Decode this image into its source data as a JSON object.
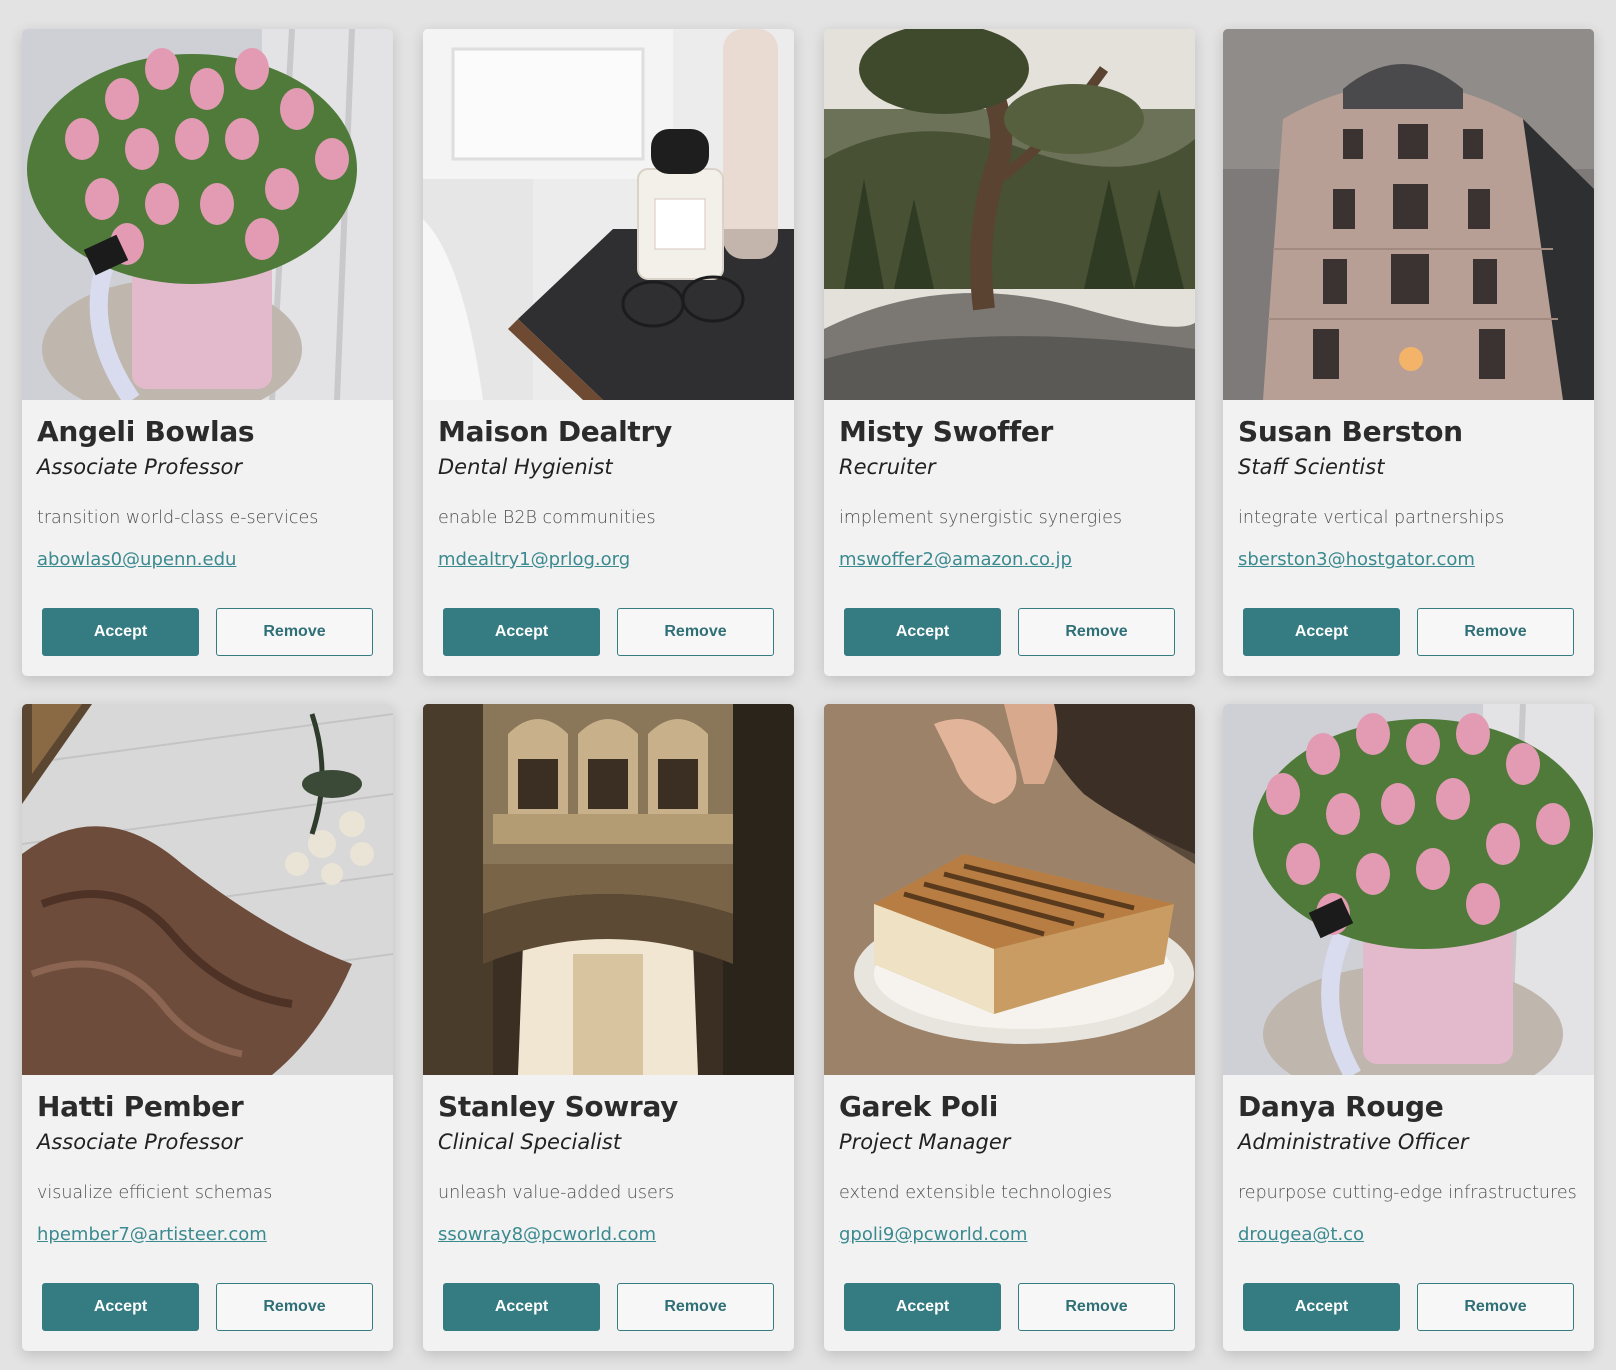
{
  "cards": [
    {
      "name": "Angeli Bowlas",
      "title": "Associate Professor",
      "tagline": "transition world-class e-services",
      "email": "abowlas0@upenn.edu",
      "image": "pink-tulips-photo",
      "accept_label": "Accept",
      "remove_label": "Remove"
    },
    {
      "name": "Maison Dealtry",
      "title": "Dental Hygienist",
      "tagline": "enable B2B communities",
      "email": "mdealtry1@prlog.org",
      "image": "perfume-glasses-photo",
      "accept_label": "Accept",
      "remove_label": "Remove"
    },
    {
      "name": "Misty Swoffer",
      "title": "Recruiter",
      "tagline": "implement synergistic synergies",
      "email": "mswoffer2@amazon.co.jp",
      "image": "pine-tree-rock-photo",
      "accept_label": "Accept",
      "remove_label": "Remove"
    },
    {
      "name": "Susan Berston",
      "title": "Staff Scientist",
      "tagline": "integrate vertical partnerships",
      "email": "sberston3@hostgator.com",
      "image": "building-facade-photo",
      "accept_label": "Accept",
      "remove_label": "Remove"
    },
    {
      "name": "Hatti Pember",
      "title": "Associate Professor",
      "tagline": "visualize efficient schemas",
      "email": "hpember7@artisteer.com",
      "image": "brown-fabric-roses-photo",
      "accept_label": "Accept",
      "remove_label": "Remove"
    },
    {
      "name": "Stanley Sowray",
      "title": "Clinical Specialist",
      "tagline": "unleash value-added users",
      "email": "ssowray8@pcworld.com",
      "image": "gothic-bridge-photo",
      "accept_label": "Accept",
      "remove_label": "Remove"
    },
    {
      "name": "Garek Poli",
      "title": "Project Manager",
      "tagline": "extend extensible technologies",
      "email": "gpoli9@pcworld.com",
      "image": "toast-sandwich-photo",
      "accept_label": "Accept",
      "remove_label": "Remove"
    },
    {
      "name": "Danya Rouge",
      "title": "Administrative Officer",
      "tagline": "repurpose cutting-edge infrastructures",
      "email": "drougea@t.co",
      "image": "pink-tulips-photo",
      "accept_label": "Accept",
      "remove_label": "Remove"
    }
  ],
  "colors": {
    "background": "#e3e3e3",
    "card": "#f2f2f2",
    "accent": "#347b82",
    "email_link": "#3b8a8f",
    "name": "#2b2b2b"
  }
}
